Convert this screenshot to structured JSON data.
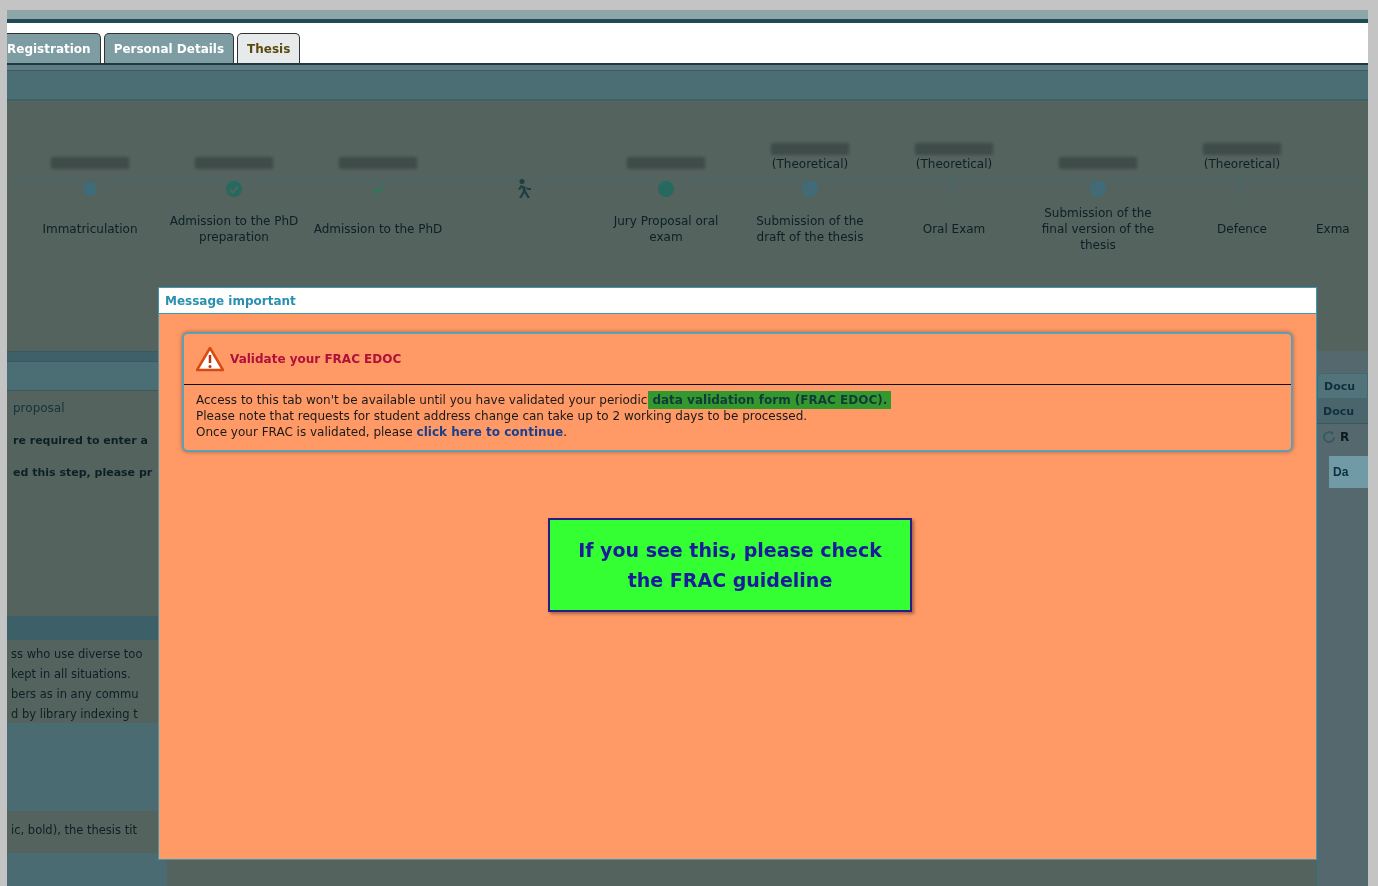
{
  "header": {
    "tabs": [
      {
        "label": "Registration",
        "selected": false
      },
      {
        "label": "Personal Details",
        "selected": false
      },
      {
        "label": "Thesis",
        "selected": true
      }
    ]
  },
  "timeline": {
    "steps": [
      {
        "date_redacted": true,
        "kind": "dot",
        "label": "Immatriculation"
      },
      {
        "date_redacted": true,
        "kind": "checkcircle",
        "label": "Admission to the PhD preparation"
      },
      {
        "date_redacted": true,
        "kind": "check",
        "label": "Admission to the PhD"
      },
      {
        "date_redacted": false,
        "kind": "walker"
      },
      {
        "date_redacted": true,
        "kind": "filled",
        "label": "Jury Proposal oral exam"
      },
      {
        "date_redacted": true,
        "subtitle": "(Theoretical)",
        "kind": "crosscircle",
        "label": "Submission of the draft of the thesis"
      },
      {
        "date_redacted": true,
        "subtitle": "(Theoretical)",
        "kind": "tick",
        "label": "Oral Exam"
      },
      {
        "date_redacted": true,
        "kind": "crosscircle",
        "label": "Submission of the final version of the thesis"
      },
      {
        "date_redacted": true,
        "subtitle": "(Theoretical)",
        "kind": "tick",
        "label": "Defence"
      },
      {
        "date_redacted": false,
        "kind": "plain",
        "label": "Exma"
      }
    ]
  },
  "background_panel": {
    "link": "proposal",
    "notes": [
      "re required to enter a",
      "ed this step, please pr"
    ],
    "paragraph_lines": [
      "ss who use diverse too",
      "kept in all situations.",
      "bers as in any commu",
      "d by library indexing t"
    ],
    "footer_line": "ic, bold), the thesis tit"
  },
  "side_panel": {
    "tabs": [
      {
        "label": "Docu",
        "selected": true
      },
      {
        "label": "Docu",
        "selected": false
      }
    ],
    "action": "R",
    "button": "Da"
  },
  "dialog": {
    "title": "Message important",
    "alert": {
      "title": "Validate your FRAC EDOC",
      "lines": [
        {
          "text": "Access to this tab won't be available until you have validated your periodic",
          "highlight": "data validation form (FRAC EDOC)."
        },
        {
          "text": "Please note that requests for student address change can take up to 2 working days to be processed."
        },
        {
          "text": "Once your FRAC is validated, please ",
          "link": "click here to continue",
          "after": "."
        }
      ]
    },
    "callout": "If you see this, please check the FRAC guideline"
  }
}
